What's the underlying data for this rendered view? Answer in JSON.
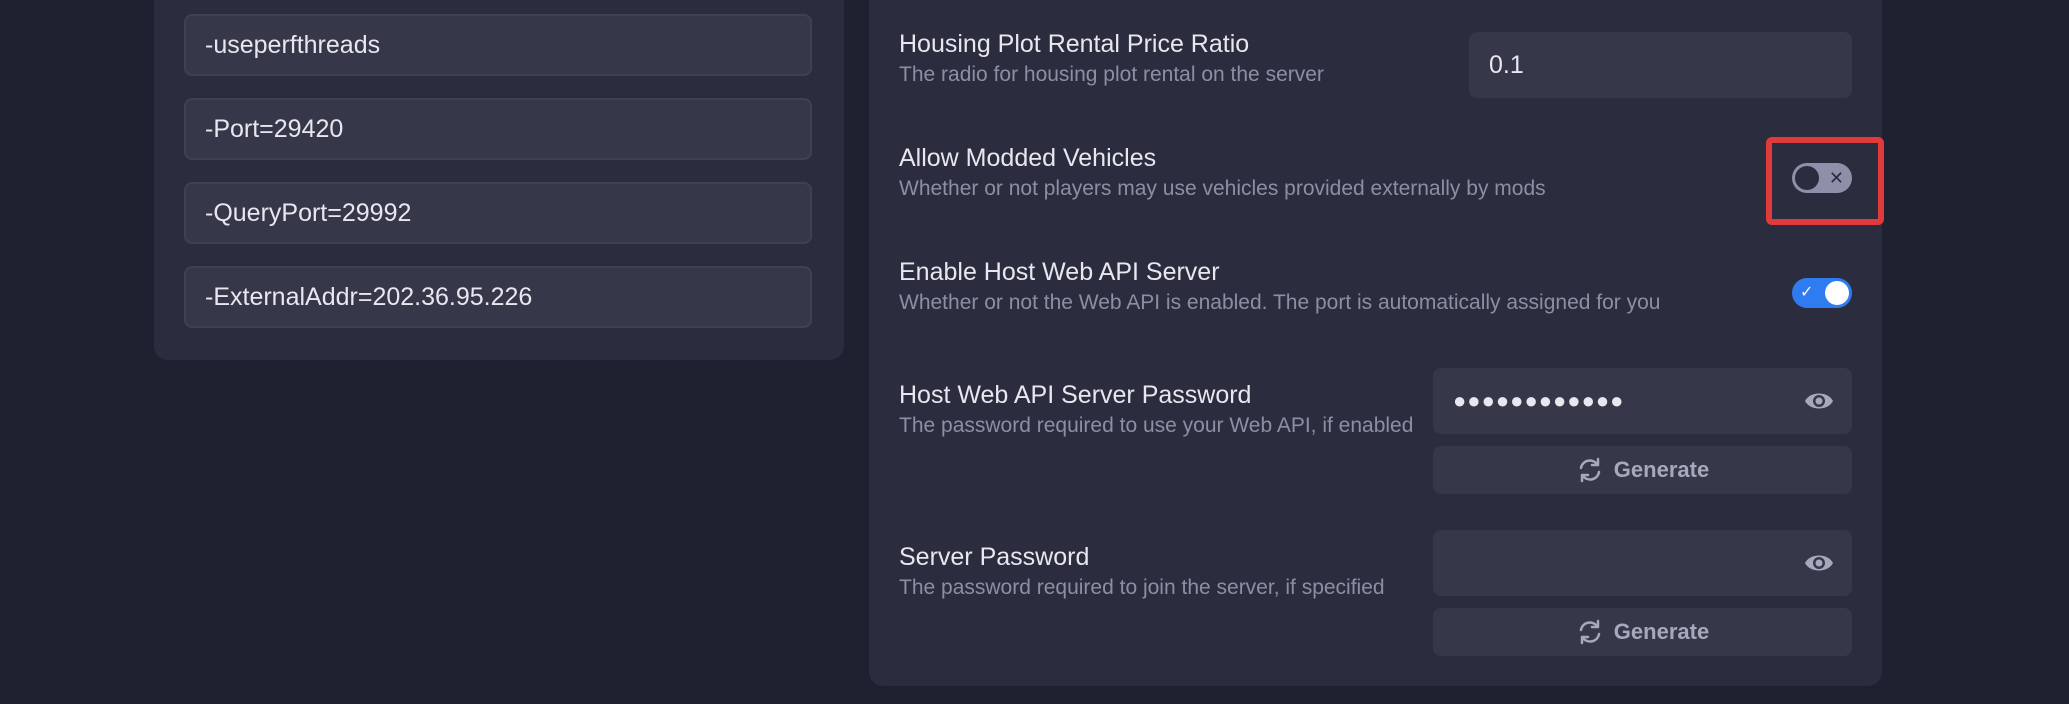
{
  "launch_args": [
    "-useperfthreads",
    "-Port=29420",
    "-QueryPort=29992",
    "-ExternalAddr=202.36.95.226"
  ],
  "settings": {
    "housing_ratio": {
      "title": "Housing Plot Rental Price Ratio",
      "desc": "The radio for housing plot rental on the server",
      "value": "0.1"
    },
    "modded_vehicles": {
      "title": "Allow Modded Vehicles",
      "desc": "Whether or not players may use vehicles provided externally by mods",
      "enabled": false,
      "mark": "✕"
    },
    "web_api": {
      "title": "Enable Host Web API Server",
      "desc": "Whether or not the Web API is enabled. The port is automatically assigned for you",
      "enabled": true,
      "mark": "✓"
    },
    "web_api_password": {
      "title": "Host Web API Server Password",
      "desc": "The password required to use your Web API, if enabled",
      "masked_value": "●●●●●●●●●●●●",
      "generate_label": "Generate"
    },
    "server_password": {
      "title": "Server Password",
      "desc": "The password required to join the server, if specified",
      "masked_value": "",
      "generate_label": "Generate"
    }
  },
  "colors": {
    "accent": "#2f7bf0",
    "highlight": "#e03a3a"
  }
}
